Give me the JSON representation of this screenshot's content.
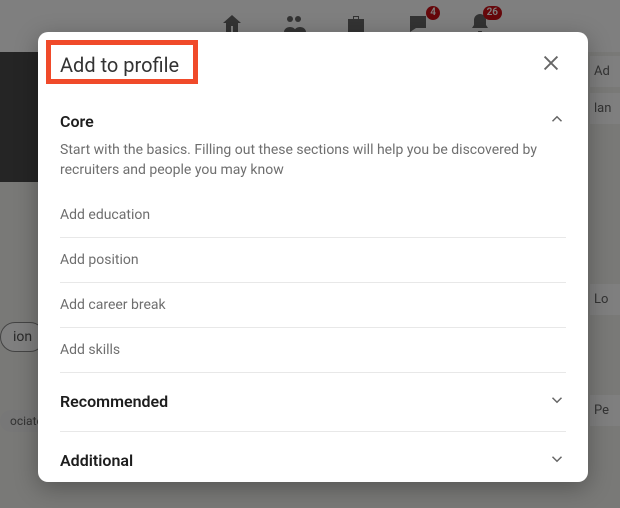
{
  "nav": {
    "messaging_badge": "4",
    "notifications_badge": "26"
  },
  "bg": {
    "pill": "ion",
    "chip": "ociate",
    "right1": "Ad",
    "right2": "lan",
    "right3": "Lo",
    "right4": "Pe"
  },
  "modal": {
    "title": "Add to profile",
    "sections": {
      "core": {
        "title": "Core",
        "desc": "Start with the basics. Filling out these sections will help you be discovered by recruiters and people you may know",
        "items": [
          "Add education",
          "Add position",
          "Add career break",
          "Add skills"
        ]
      },
      "recommended": {
        "title": "Recommended"
      },
      "additional": {
        "title": "Additional"
      }
    }
  }
}
